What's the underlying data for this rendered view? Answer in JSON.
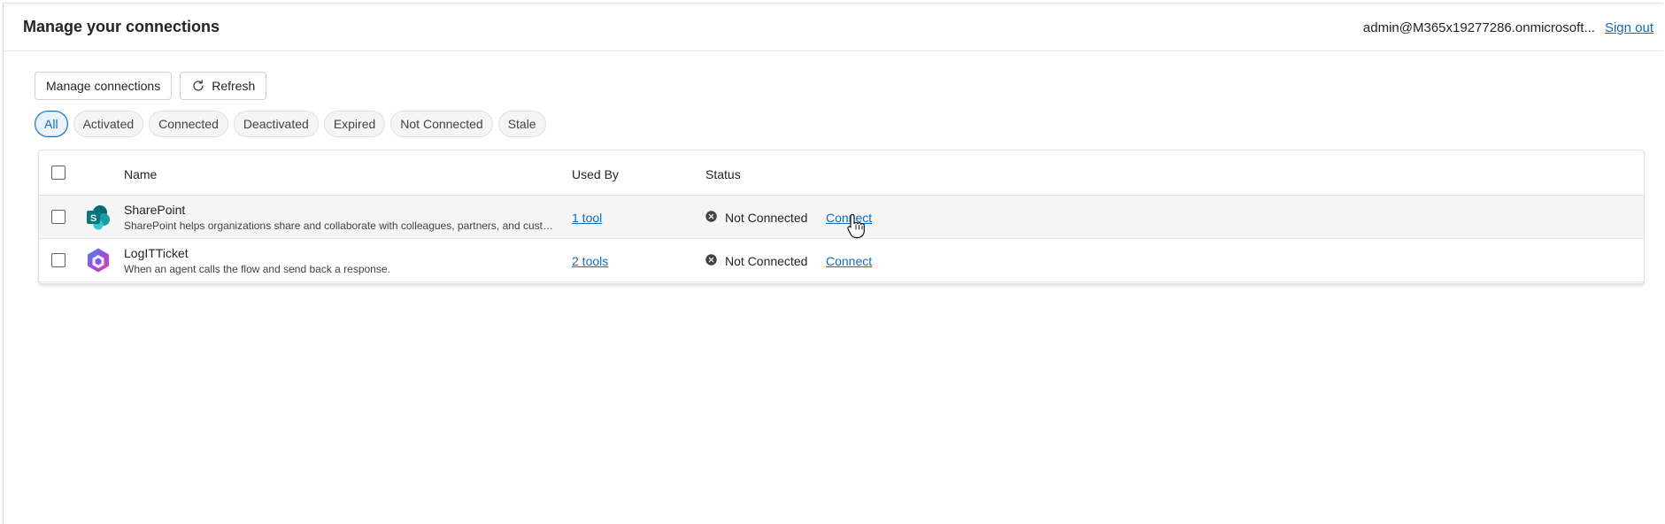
{
  "header": {
    "title": "Manage your connections",
    "account_email": "admin@M365x19277286.onmicrosoft...",
    "sign_out_label": "Sign out"
  },
  "toolbar": {
    "manage_label": "Manage connections",
    "refresh_label": "Refresh",
    "refresh_icon": "refresh-icon"
  },
  "filters": [
    "All",
    "Activated",
    "Connected",
    "Deactivated",
    "Expired",
    "Not Connected",
    "Stale"
  ],
  "active_filter": "All",
  "table": {
    "columns": {
      "name": "Name",
      "used_by": "Used By",
      "status": "Status"
    },
    "rows": [
      {
        "name": "SharePoint",
        "description": "SharePoint helps organizations share and collaborate with colleagues, partners, and customers.",
        "used_by": "1 tool",
        "status": "Not Connected",
        "action": "Connect",
        "icon": "sharepoint-icon"
      },
      {
        "name": "LogITTicket",
        "description": "When an agent calls the flow and send back a response.",
        "used_by": "2 tools",
        "status": "Not Connected",
        "action": "Connect",
        "icon": "power-automate-icon"
      }
    ]
  },
  "colors": {
    "accent": "#0f6cbd",
    "sharepoint": "#03787c",
    "status_icon": "#424242"
  }
}
